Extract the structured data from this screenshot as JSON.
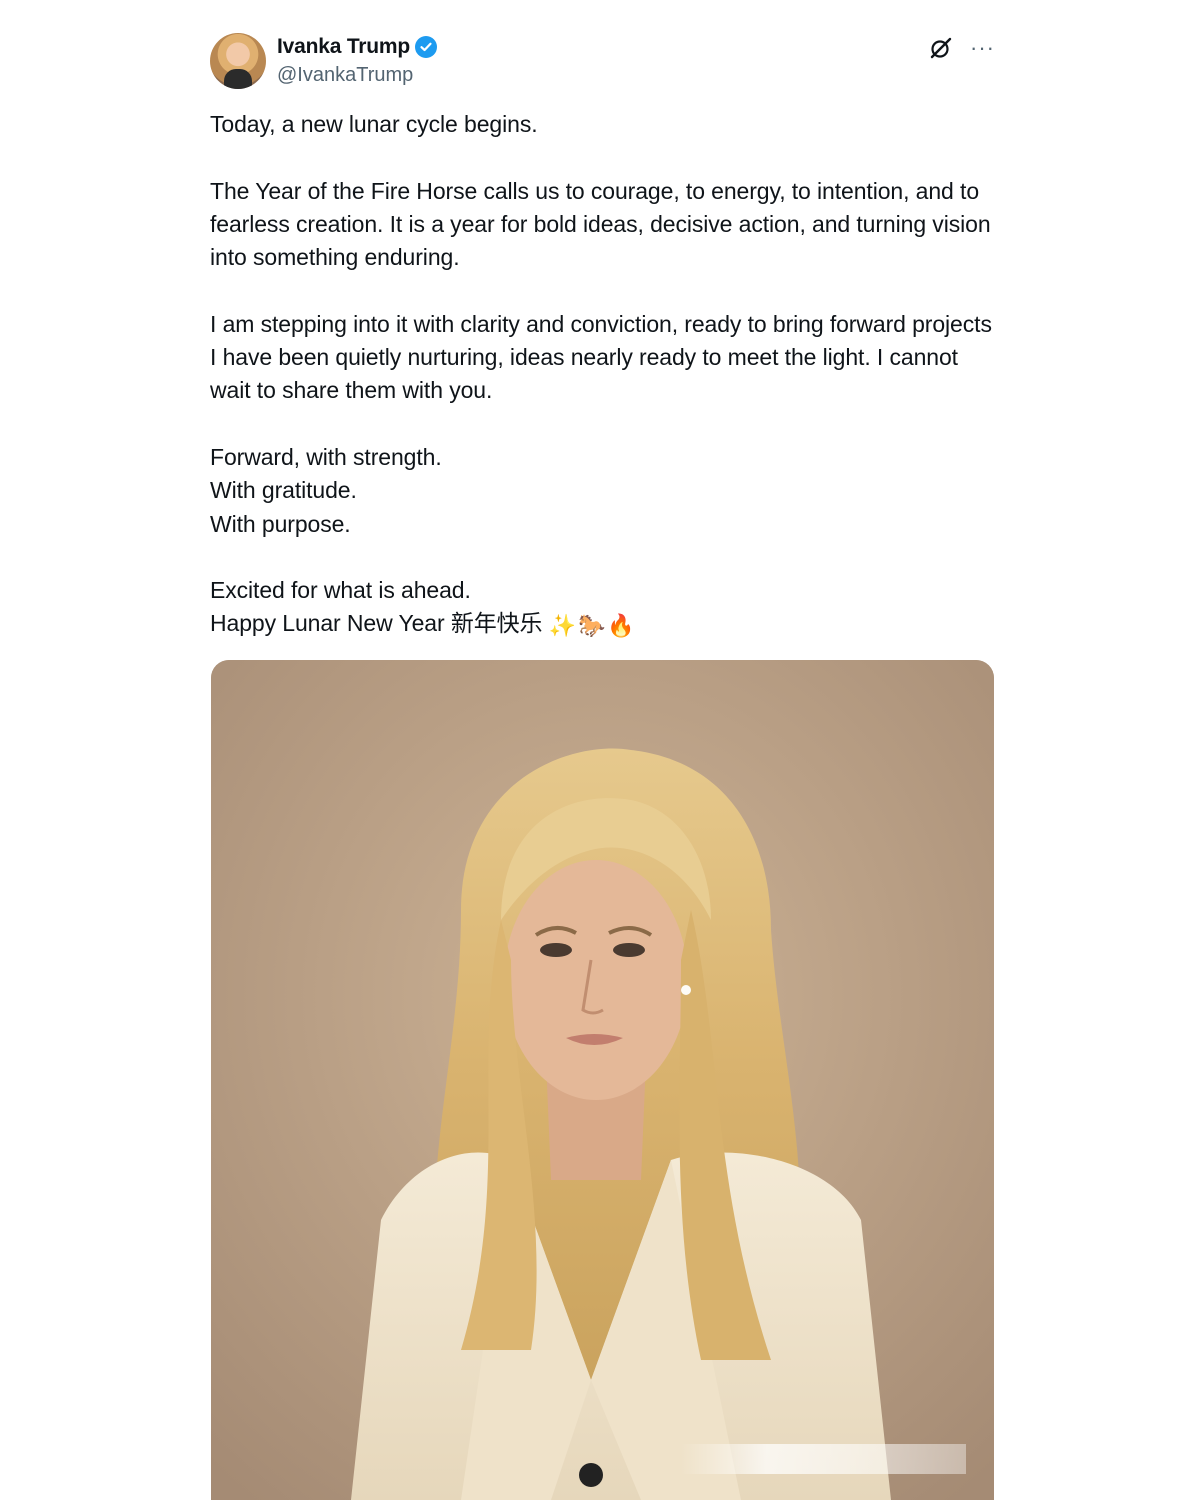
{
  "author": {
    "display_name": "Ivanka Trump",
    "handle": "@IvankaTrump",
    "verified": true
  },
  "icons": {
    "verified": "verified-badge-icon",
    "grok": "grok-icon",
    "more": "more-options-icon"
  },
  "post": {
    "paragraph_1": "Today, a new lunar cycle begins.",
    "paragraph_2": "The Year of the Fire Horse calls us to courage, to energy, to intention, and to fearless creation. It is a year for bold ideas, decisive action, and turning vision into something enduring.",
    "paragraph_3": "I am stepping into it with clarity and conviction, ready to bring forward projects I have been quietly nurturing, ideas nearly ready to meet the light. I cannot wait to share them with you.",
    "line_4a": "Forward, with strength.",
    "line_4b": "With gratitude.",
    "line_4c": "With purpose.",
    "line_5a": "Excited for what is ahead.",
    "line_5b": "Happy Lunar New Year 新年快乐",
    "emojis": [
      "✨",
      "🐎",
      "🔥"
    ]
  },
  "colors": {
    "verified": "#1d9bf0",
    "secondary_text": "#536471",
    "text": "#0f1419"
  }
}
